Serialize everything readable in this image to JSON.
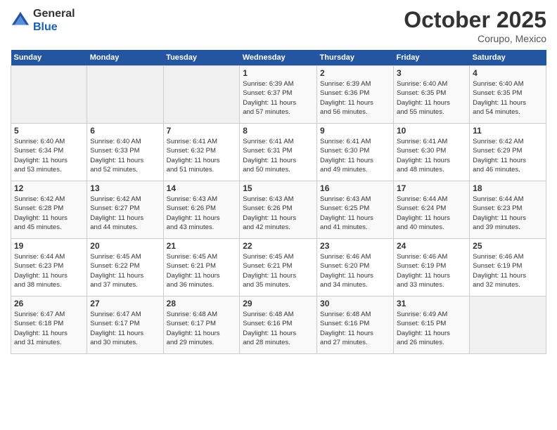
{
  "header": {
    "logo_line1": "General",
    "logo_line2": "Blue",
    "month": "October 2025",
    "location": "Corupo, Mexico"
  },
  "days_of_week": [
    "Sunday",
    "Monday",
    "Tuesday",
    "Wednesday",
    "Thursday",
    "Friday",
    "Saturday"
  ],
  "weeks": [
    [
      {
        "day": "",
        "info": ""
      },
      {
        "day": "",
        "info": ""
      },
      {
        "day": "",
        "info": ""
      },
      {
        "day": "1",
        "info": "Sunrise: 6:39 AM\nSunset: 6:37 PM\nDaylight: 11 hours\nand 57 minutes."
      },
      {
        "day": "2",
        "info": "Sunrise: 6:39 AM\nSunset: 6:36 PM\nDaylight: 11 hours\nand 56 minutes."
      },
      {
        "day": "3",
        "info": "Sunrise: 6:40 AM\nSunset: 6:35 PM\nDaylight: 11 hours\nand 55 minutes."
      },
      {
        "day": "4",
        "info": "Sunrise: 6:40 AM\nSunset: 6:35 PM\nDaylight: 11 hours\nand 54 minutes."
      }
    ],
    [
      {
        "day": "5",
        "info": "Sunrise: 6:40 AM\nSunset: 6:34 PM\nDaylight: 11 hours\nand 53 minutes."
      },
      {
        "day": "6",
        "info": "Sunrise: 6:40 AM\nSunset: 6:33 PM\nDaylight: 11 hours\nand 52 minutes."
      },
      {
        "day": "7",
        "info": "Sunrise: 6:41 AM\nSunset: 6:32 PM\nDaylight: 11 hours\nand 51 minutes."
      },
      {
        "day": "8",
        "info": "Sunrise: 6:41 AM\nSunset: 6:31 PM\nDaylight: 11 hours\nand 50 minutes."
      },
      {
        "day": "9",
        "info": "Sunrise: 6:41 AM\nSunset: 6:30 PM\nDaylight: 11 hours\nand 49 minutes."
      },
      {
        "day": "10",
        "info": "Sunrise: 6:41 AM\nSunset: 6:30 PM\nDaylight: 11 hours\nand 48 minutes."
      },
      {
        "day": "11",
        "info": "Sunrise: 6:42 AM\nSunset: 6:29 PM\nDaylight: 11 hours\nand 46 minutes."
      }
    ],
    [
      {
        "day": "12",
        "info": "Sunrise: 6:42 AM\nSunset: 6:28 PM\nDaylight: 11 hours\nand 45 minutes."
      },
      {
        "day": "13",
        "info": "Sunrise: 6:42 AM\nSunset: 6:27 PM\nDaylight: 11 hours\nand 44 minutes."
      },
      {
        "day": "14",
        "info": "Sunrise: 6:43 AM\nSunset: 6:26 PM\nDaylight: 11 hours\nand 43 minutes."
      },
      {
        "day": "15",
        "info": "Sunrise: 6:43 AM\nSunset: 6:26 PM\nDaylight: 11 hours\nand 42 minutes."
      },
      {
        "day": "16",
        "info": "Sunrise: 6:43 AM\nSunset: 6:25 PM\nDaylight: 11 hours\nand 41 minutes."
      },
      {
        "day": "17",
        "info": "Sunrise: 6:44 AM\nSunset: 6:24 PM\nDaylight: 11 hours\nand 40 minutes."
      },
      {
        "day": "18",
        "info": "Sunrise: 6:44 AM\nSunset: 6:23 PM\nDaylight: 11 hours\nand 39 minutes."
      }
    ],
    [
      {
        "day": "19",
        "info": "Sunrise: 6:44 AM\nSunset: 6:23 PM\nDaylight: 11 hours\nand 38 minutes."
      },
      {
        "day": "20",
        "info": "Sunrise: 6:45 AM\nSunset: 6:22 PM\nDaylight: 11 hours\nand 37 minutes."
      },
      {
        "day": "21",
        "info": "Sunrise: 6:45 AM\nSunset: 6:21 PM\nDaylight: 11 hours\nand 36 minutes."
      },
      {
        "day": "22",
        "info": "Sunrise: 6:45 AM\nSunset: 6:21 PM\nDaylight: 11 hours\nand 35 minutes."
      },
      {
        "day": "23",
        "info": "Sunrise: 6:46 AM\nSunset: 6:20 PM\nDaylight: 11 hours\nand 34 minutes."
      },
      {
        "day": "24",
        "info": "Sunrise: 6:46 AM\nSunset: 6:19 PM\nDaylight: 11 hours\nand 33 minutes."
      },
      {
        "day": "25",
        "info": "Sunrise: 6:46 AM\nSunset: 6:19 PM\nDaylight: 11 hours\nand 32 minutes."
      }
    ],
    [
      {
        "day": "26",
        "info": "Sunrise: 6:47 AM\nSunset: 6:18 PM\nDaylight: 11 hours\nand 31 minutes."
      },
      {
        "day": "27",
        "info": "Sunrise: 6:47 AM\nSunset: 6:17 PM\nDaylight: 11 hours\nand 30 minutes."
      },
      {
        "day": "28",
        "info": "Sunrise: 6:48 AM\nSunset: 6:17 PM\nDaylight: 11 hours\nand 29 minutes."
      },
      {
        "day": "29",
        "info": "Sunrise: 6:48 AM\nSunset: 6:16 PM\nDaylight: 11 hours\nand 28 minutes."
      },
      {
        "day": "30",
        "info": "Sunrise: 6:48 AM\nSunset: 6:16 PM\nDaylight: 11 hours\nand 27 minutes."
      },
      {
        "day": "31",
        "info": "Sunrise: 6:49 AM\nSunset: 6:15 PM\nDaylight: 11 hours\nand 26 minutes."
      },
      {
        "day": "",
        "info": ""
      }
    ]
  ]
}
